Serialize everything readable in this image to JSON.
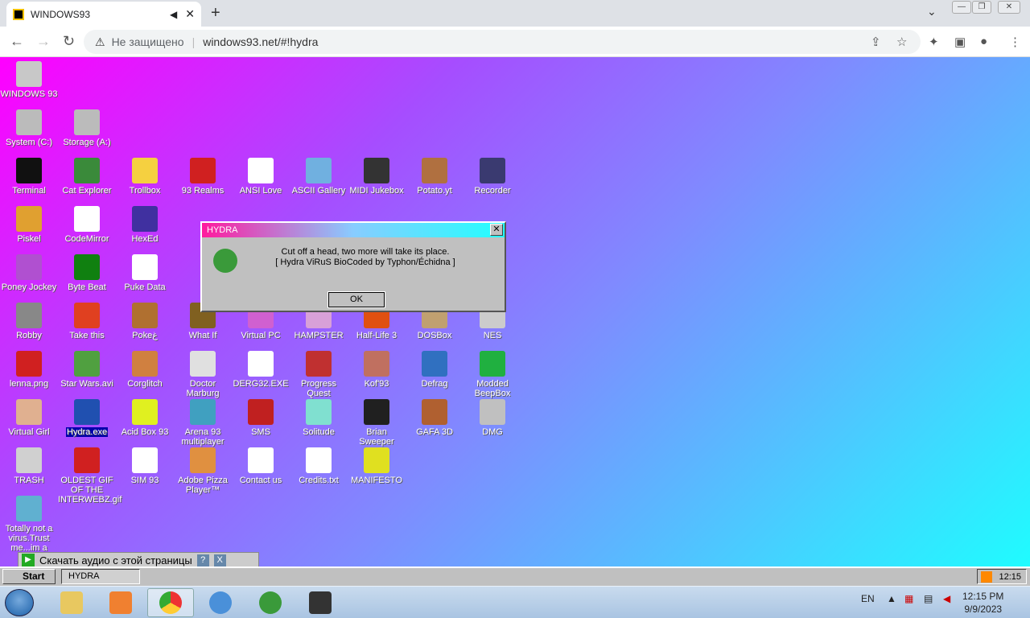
{
  "browser": {
    "tab_title": "WINDOWS93",
    "not_secure": "Не защищено",
    "url": "windows93.net/#!hydra"
  },
  "desktop_icons": [
    {
      "label": "WINDOWS 93",
      "color": "#c8c8c8"
    },
    {
      "label": "System (C:)",
      "color": "#bbbbbb"
    },
    {
      "label": "Storage (A:)",
      "color": "#bbbbbb"
    },
    {
      "label": "Terminal",
      "color": "#111111"
    },
    {
      "label": "Cat Explorer",
      "color": "#3a8a3a"
    },
    {
      "label": "Trollbox",
      "color": "#f5d040"
    },
    {
      "label": "93 Realms",
      "color": "#d02020"
    },
    {
      "label": "ANSI Love",
      "color": "#ffffff"
    },
    {
      "label": "ASCII Gallery",
      "color": "#70b0e0"
    },
    {
      "label": "MIDI Jukebox",
      "color": "#333333"
    },
    {
      "label": "Potato.yt",
      "color": "#b07040"
    },
    {
      "label": "Recorder",
      "color": "#3a3a70"
    },
    {
      "label": "Piskel",
      "color": "#e0a030"
    },
    {
      "label": "CodeMirror",
      "color": "#ffffff"
    },
    {
      "label": "HexEd",
      "color": "#4030a0"
    },
    {
      "label": "Poney Jockey",
      "color": "#b050d0"
    },
    {
      "label": "Byte Beat",
      "color": "#108010"
    },
    {
      "label": "Puke Data",
      "color": "#ffffff"
    },
    {
      "label": "Robby",
      "color": "#888888"
    },
    {
      "label": "Take this",
      "color": "#e04020"
    },
    {
      "label": "Pokeغ",
      "color": "#b07030"
    },
    {
      "label": "What If",
      "color": "#806020"
    },
    {
      "label": "Virtual PC",
      "color": "#d060d0"
    },
    {
      "label": "HAMPSTER",
      "color": "#d8a0d8"
    },
    {
      "label": "Half-Life 3",
      "color": "#e05010"
    },
    {
      "label": "DOSBox",
      "color": "#c0a070"
    },
    {
      "label": "NES",
      "color": "#cccccc"
    },
    {
      "label": "lenna.png",
      "color": "#d02020"
    },
    {
      "label": "Star Wars.avi",
      "color": "#50a040"
    },
    {
      "label": "Corglitch",
      "color": "#d08040"
    },
    {
      "label": "Doctor Marburg",
      "color": "#e0e0e0"
    },
    {
      "label": "DERG32.EXE",
      "color": "#ffffff"
    },
    {
      "label": "Progress Quest",
      "color": "#c03030"
    },
    {
      "label": "Kof'93",
      "color": "#c07060"
    },
    {
      "label": "Defrag",
      "color": "#3070c0"
    },
    {
      "label": "Modded BeepBox",
      "color": "#20b040"
    },
    {
      "label": "Virtual Girl",
      "color": "#e0b090"
    },
    {
      "label": "Hydra.exe",
      "color": "#2050b0"
    },
    {
      "label": "Acid Box 93",
      "color": "#e0f020"
    },
    {
      "label": "Arena 93 multiplayer",
      "color": "#40a0c0"
    },
    {
      "label": "SMS",
      "color": "#c02020"
    },
    {
      "label": "Solitude",
      "color": "#80e0d0"
    },
    {
      "label": "Brian Sweeper",
      "color": "#202020"
    },
    {
      "label": "GAFA 3D",
      "color": "#b06030"
    },
    {
      "label": "DMG",
      "color": "#c0c0c0"
    },
    {
      "label": "TRASH",
      "color": "#d0d0d0"
    },
    {
      "label": "OLDEST GIF OF THE INTERWEBZ.gif",
      "color": "#d02020"
    },
    {
      "label": "SIM 93",
      "color": "#ffffff"
    },
    {
      "label": "Adobe Pizza Player™",
      "color": "#e09040"
    },
    {
      "label": "Contact us",
      "color": "#ffffff"
    },
    {
      "label": "Credits.txt",
      "color": "#ffffff"
    },
    {
      "label": "MANIFESTO",
      "color": "#e0e020"
    },
    {
      "label": "Totally not a virus.Trust me...im a",
      "color": "#60b0d0"
    }
  ],
  "dialog": {
    "title": "HYDRA",
    "line1": "Cut off a head, two more will take its place.",
    "line2": "[ Hydra ViRuS BioCoded by Typhon/Échidna ]",
    "ok": "OK"
  },
  "download_bar": {
    "label": "Скачать аудио с этой страницы",
    "help": "?",
    "close": "X"
  },
  "taskbar93": {
    "start": "Start",
    "task": "HYDRA",
    "clock": "12:15"
  },
  "taskbar7": {
    "lang": "EN",
    "time": "12:15 PM",
    "date": "9/9/2023"
  }
}
